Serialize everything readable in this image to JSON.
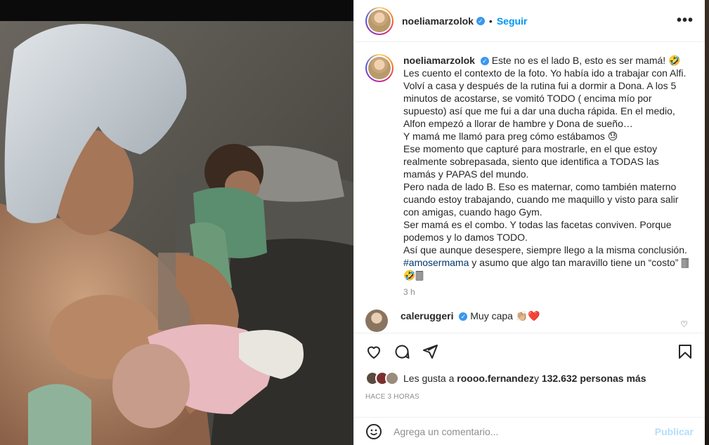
{
  "post": {
    "username": "noeliamarzolok",
    "verified_glyph": "✓",
    "separator": "•",
    "follow_label": "Seguir",
    "more_label": "•••",
    "caption": "Este no es el lado B, esto es ser mamá! 🤣\nLes cuento el contexto de la foto. Yo había ido a trabajar con Alfi. Volví a casa y después de la rutina fui a dormir a Dona. A los 5 minutos de acostarse, se vomitó TODO ( encima mío por supuesto) así que me fui a dar una ducha rápida. En el medio, Alfon empezó a llorar de hambre y Dona de sueño…\nY mamá me llamó para preg cómo estábamos 😓\nEse momento que capturé para mostrarle, en el que estoy realmente sobrepasada, siento que identifica a TODAS las mamás y PAPAS del mundo.\nPero nada de lado B. Eso es maternar, como también materno cuando estoy trabajando, cuando me maquillo y visto para salir con amigas, cuando hago Gym.\nSer mamá es el combo. Y todas las facetas conviven. Porque podemos y lo damos TODO.\nAsí que aunque desespere, siempre llego a la misma conclusión. ",
    "hashtag": "#amosermama",
    "caption_end": " y asumo que algo tan maravillo tiene un “costo” 🀫🤣🀫",
    "caption_time": "3 h"
  },
  "comment": {
    "username": "caleruggeri",
    "text": "Muy capa 👏🏼❤️",
    "heart_icon": "♡"
  },
  "likes": {
    "prefix": "Les gusta a ",
    "user": "roooo.fernandez",
    "middle": " y ",
    "count": "132.632 personas más"
  },
  "time_ago": "HACE 3 HORAS",
  "add_comment": {
    "placeholder": "Agrega un comentario...",
    "publish_label": "Publicar"
  },
  "icons": [
    "heart-icon",
    "comment-icon",
    "share-icon",
    "save-icon",
    "emoji-icon",
    "more-icon"
  ],
  "colors": {
    "link": "#0095f6",
    "verified": "#3897f0",
    "publish_disabled": "#b2dffc",
    "muted": "#8e8e8e"
  }
}
